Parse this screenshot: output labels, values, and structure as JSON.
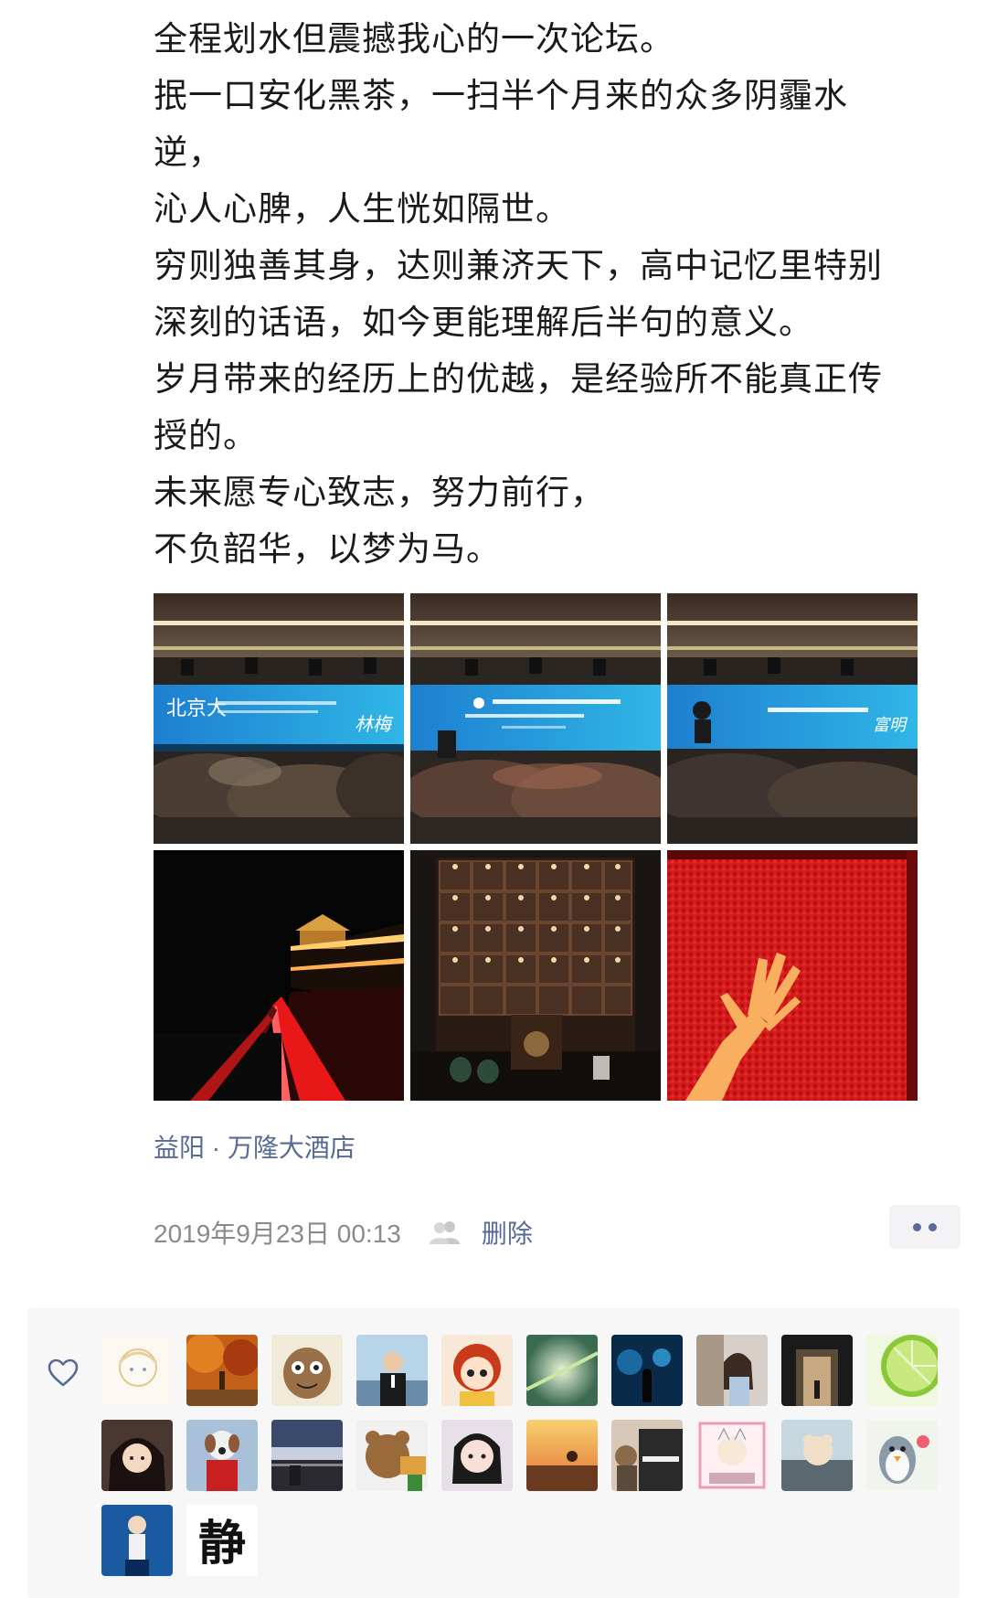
{
  "post": {
    "lines": [
      "全程划水但震撼我心的一次论坛。",
      "抿一口安化黑茶，一扫半个月来的众多阴霾水",
      "逆，",
      "沁人心脾，人生恍如隔世。",
      "穷则独善其身，达则兼济天下，高中记忆里特别",
      "深刻的话语，如今更能理解后半句的意义。",
      "岁月带来的经历上的优越，是经验所不能真正传",
      "授的。",
      "未来愿专心致志，努力前行，",
      "不负韶华，以梦为马。"
    ],
    "photos": [
      {
        "name": "photo-forum-stage-1",
        "slide_text": "北京大",
        "speaker_text": "林梅"
      },
      {
        "name": "photo-forum-stage-2"
      },
      {
        "name": "photo-forum-stage-3",
        "speaker_text": "富明"
      },
      {
        "name": "photo-night-pavilion"
      },
      {
        "name": "photo-tea-cabinet"
      },
      {
        "name": "photo-hand-red-wall"
      }
    ],
    "location": "益阳 · 万隆大酒店",
    "timestamp": "2019年9月23日 00:13",
    "delete_label": "删除",
    "visibility_icon": "friends-group-icon",
    "more_icon": "more-dots-icon"
  },
  "likes": {
    "icon": "heart-outline-icon",
    "avatar_count": 22,
    "avatar_last_glyph": "静"
  },
  "colors": {
    "link": "#576b95",
    "meta_gray": "#8a8a8a",
    "panel_bg": "#f7f7f7"
  }
}
